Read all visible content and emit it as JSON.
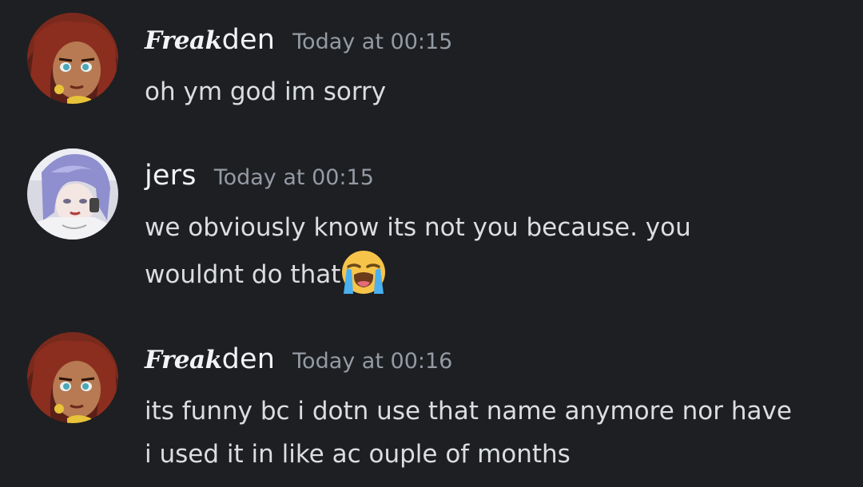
{
  "messages": [
    {
      "username_fancy": "Freak",
      "username_plain": "den",
      "timestamp": "Today at 00:15",
      "lines": [
        "oh ym god im sorry"
      ]
    },
    {
      "username_plain": "jers",
      "timestamp": "Today at 00:15",
      "lines": [
        "we obviously know its not you because. you",
        "wouldnt do that"
      ],
      "emoji": "loudly-crying-face"
    },
    {
      "username_fancy": "Freak",
      "username_plain": "den",
      "timestamp": "Today at 00:16",
      "lines": [
        "its funny bc i dotn use that name anymore nor have",
        "i used it in like ac ouple of months"
      ]
    }
  ],
  "colors": {
    "background": "#1e1f22",
    "username": "#f2f3f5",
    "timestamp": "#949ba4",
    "text": "#dbdee1"
  }
}
